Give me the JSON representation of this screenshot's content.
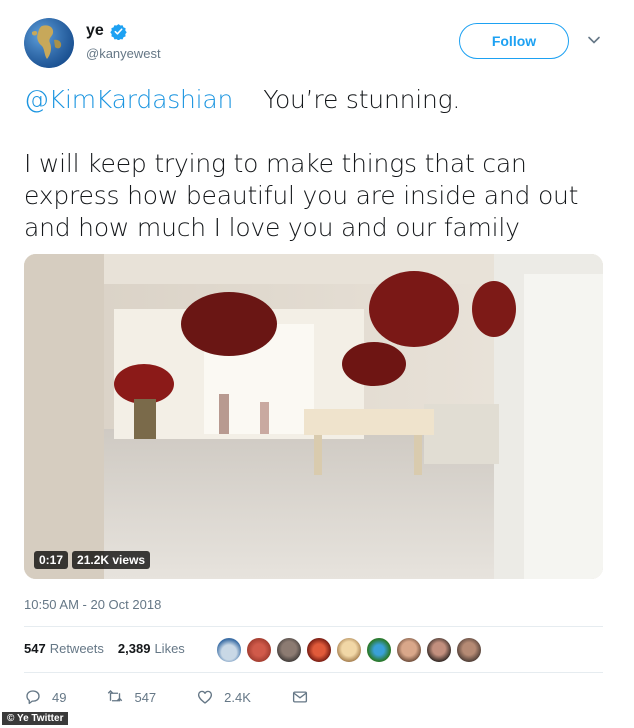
{
  "user": {
    "display_name": "ye",
    "handle": "@kanyewest",
    "verified": true,
    "avatar_icon": "globe-icon"
  },
  "follow_label": "Follow",
  "tweet": {
    "mention": "@KimKardashian",
    "first_line": "You’re stunning.",
    "body": "I will keep trying to make things that can express how beautiful you are inside and out and how much I love you and our family"
  },
  "video": {
    "duration": "0:17",
    "views": "21.2K views"
  },
  "timestamp": "10:50 AM - 20 Oct 2018",
  "stats": {
    "retweets_count": "547",
    "retweets_label": "Retweets",
    "likes_count": "2,389",
    "likes_label": "Likes"
  },
  "actions": {
    "replies": "49",
    "retweets": "547",
    "likes": "2.4K"
  },
  "watermark": "© Ye Twitter",
  "colors": {
    "accent": "#1da1f2",
    "mention": "#1b95e0",
    "muted": "#657786"
  }
}
